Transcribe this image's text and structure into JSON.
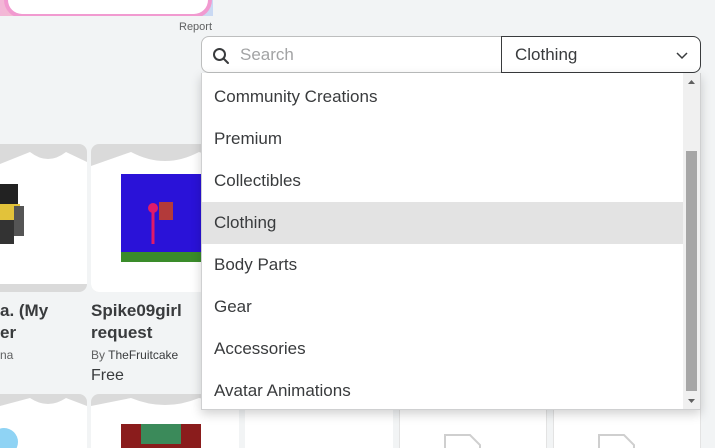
{
  "ad": {
    "report_label": "Report"
  },
  "search": {
    "placeholder": "Search",
    "value": ""
  },
  "category_select": {
    "selected": "Clothing"
  },
  "dropdown": {
    "items": [
      "Community Creations",
      "Premium",
      "Collectibles",
      "Clothing",
      "Body Parts",
      "Gear",
      "Accessories",
      "Avatar Animations"
    ],
    "highlighted": "Clothing"
  },
  "catalog": {
    "items": [
      {
        "name_line1": "a. (My",
        "name_line2": "er",
        "creator": "na"
      },
      {
        "name_line1": "Spike09girl",
        "name_line2": "request",
        "by_prefix": "By",
        "creator": "TheFruitcake",
        "price": "Free"
      }
    ]
  },
  "colors": {
    "accent_border": "#393b3d",
    "menu_highlight": "#e3e3e3",
    "background": "#f2f4f5"
  }
}
